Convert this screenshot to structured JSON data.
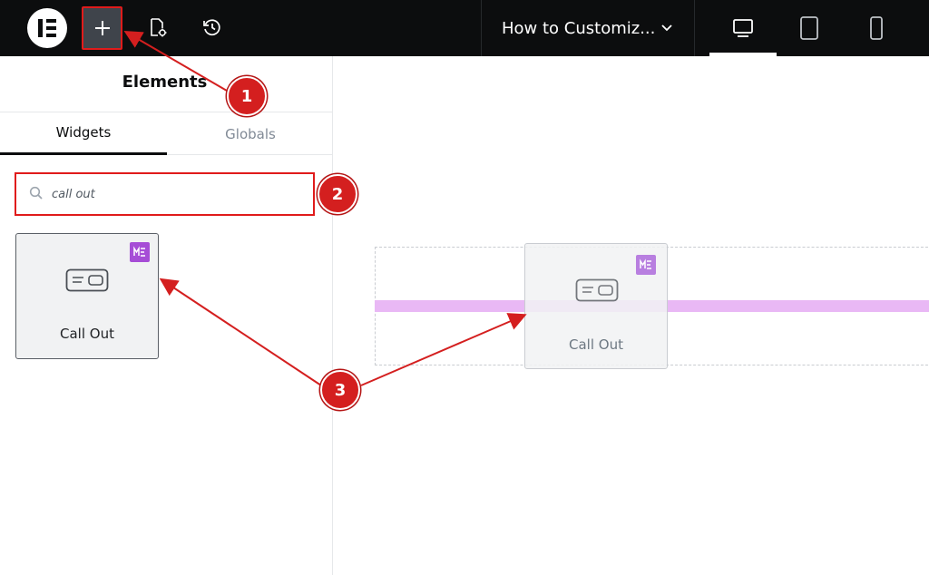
{
  "topbar": {
    "page_title": "How to Customiz...",
    "icons": [
      "elementor-logo-icon",
      "plus-icon",
      "page-settings-icon",
      "history-icon",
      "chevron-down-icon",
      "desktop-icon",
      "tablet-icon",
      "mobile-icon"
    ],
    "active_device": "desktop"
  },
  "panel": {
    "title": "Elements",
    "tabs": [
      {
        "label": "Widgets",
        "active": true
      },
      {
        "label": "Globals",
        "active": false
      }
    ],
    "search": {
      "value": "call out"
    },
    "widgets": [
      {
        "label": "Call Out",
        "badge": "ME"
      }
    ]
  },
  "canvas": {
    "dragged_widget": {
      "label": "Call Out",
      "badge": "ME"
    }
  },
  "annotations": {
    "steps": [
      "1",
      "2",
      "3"
    ],
    "color": "#d41f1f"
  },
  "colors": {
    "topbar_bg": "#0c0d0e",
    "highlight_border": "#e01b1b",
    "drop_indicator": "#e9b8f5",
    "badge_bg": "#a64dd6"
  }
}
